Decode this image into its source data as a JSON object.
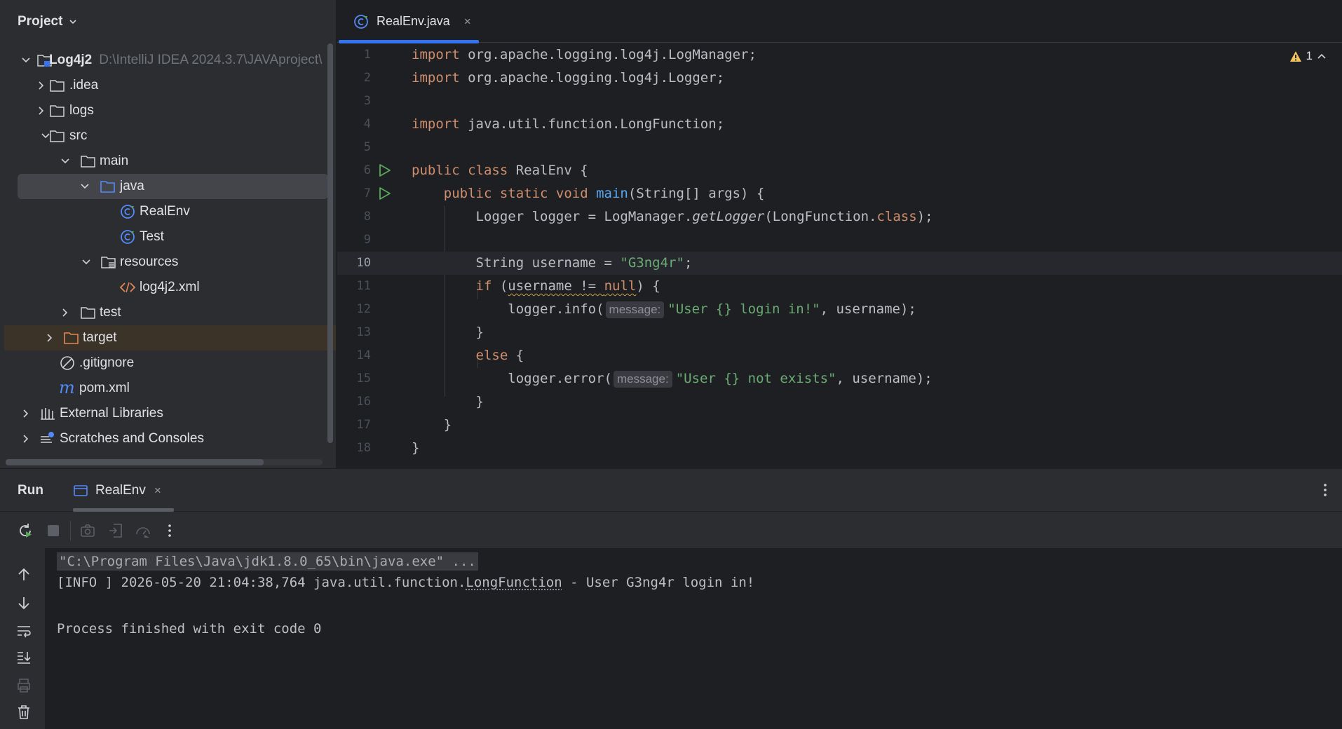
{
  "project": {
    "title": "Project",
    "tree": [
      {
        "label": "Log4j2",
        "hint": "D:\\IntelliJ IDEA 2024.3.7\\JAVAproject\\",
        "level": 0,
        "expanded": true,
        "icon": "module-folder-icon"
      },
      {
        "label": ".idea",
        "level": 1,
        "expanded": false,
        "icon": "folder-icon"
      },
      {
        "label": "logs",
        "level": 1,
        "expanded": false,
        "icon": "folder-icon"
      },
      {
        "label": "src",
        "level": 1,
        "expanded": true,
        "icon": "folder-icon"
      },
      {
        "label": "main",
        "level": 2,
        "expanded": true,
        "icon": "folder-icon"
      },
      {
        "label": "java",
        "level": 3,
        "expanded": true,
        "icon": "source-folder-icon"
      },
      {
        "label": "RealEnv",
        "level": 4,
        "icon": "java-class-icon"
      },
      {
        "label": "Test",
        "level": 4,
        "icon": "java-class-icon"
      },
      {
        "label": "resources",
        "level": 3,
        "expanded": true,
        "icon": "resources-folder-icon"
      },
      {
        "label": "log4j2.xml",
        "level": 4,
        "icon": "xml-file-icon"
      },
      {
        "label": "test",
        "level": 2,
        "expanded": false,
        "icon": "folder-icon"
      },
      {
        "label": "target",
        "level": 1,
        "expanded": false,
        "icon": "excluded-folder-icon"
      },
      {
        "label": ".gitignore",
        "level": 1,
        "icon": "ignore-file-icon"
      },
      {
        "label": "pom.xml",
        "level": 1,
        "icon": "maven-icon"
      },
      {
        "label": "External Libraries",
        "level": 0,
        "expanded": false,
        "icon": "libraries-icon"
      },
      {
        "label": "Scratches and Consoles",
        "level": 0,
        "expanded": false,
        "icon": "scratches-icon"
      }
    ]
  },
  "editor": {
    "tab": {
      "label": "RealEnv.java",
      "close": "×"
    },
    "warnings": "1",
    "current_line": 10,
    "line_numbers": [
      "1",
      "2",
      "3",
      "4",
      "5",
      "6",
      "7",
      "8",
      "9",
      "10",
      "11",
      "12",
      "13",
      "14",
      "15",
      "16",
      "17",
      "18"
    ],
    "code": {
      "l1": {
        "kw": "import",
        "rest": " org.apache.logging.log4j.LogManager;"
      },
      "l2": {
        "kw": "import",
        "rest": " org.apache.logging.log4j.Logger;"
      },
      "l4": {
        "kw": "import",
        "rest": " java.util.function.LongFunction;"
      },
      "l6": {
        "kw": "public class",
        "rest": " RealEnv {"
      },
      "l7": {
        "kw": "    public static void ",
        "fn": "main",
        "rest": "(String[] args) {"
      },
      "l8": {
        "a": "        Logger logger = LogManager.",
        "it": "getLogger",
        "b": "(LongFunction.",
        "kw": "class",
        "c": ");"
      },
      "l10": {
        "a": "        String username = ",
        "str": "\"G3ng4r\"",
        "c": ";"
      },
      "l11": {
        "a": "        ",
        "kw1": "if",
        "b": " (",
        "w1": "username != ",
        "kw2": "null",
        "c": ") {"
      },
      "l12": {
        "a": "            logger.info(",
        "hint": "message:",
        "str": "\"User {} login in!\"",
        "c": ", username);"
      },
      "l13": {
        "a": "        }"
      },
      "l14": {
        "a": "        ",
        "kw": "else",
        "c": " {"
      },
      "l15": {
        "a": "            logger.error(",
        "hint": "message:",
        "str": "\"User {} not exists\"",
        "c": ", username);"
      },
      "l16": {
        "a": "        }"
      },
      "l17": {
        "a": "    }"
      },
      "l18": {
        "a": "}"
      }
    }
  },
  "run": {
    "title": "Run",
    "tab": {
      "label": "RealEnv",
      "close": "×"
    },
    "console": {
      "cmd": "\"C:\\Program Files\\Java\\jdk1.8.0_65\\bin\\java.exe\" ...",
      "log_prefix": "[INFO ] 2026-05-20 21:04:38,764 java.util.function.",
      "log_class": "LongFunction",
      "log_suffix": " - User G3ng4r login in!",
      "exit": "Process finished with exit code 0"
    }
  },
  "colors": {
    "accent": "#3574f0",
    "keyword": "#cf8e6d",
    "string": "#6aab73",
    "function": "#56a8f5",
    "run_gutter": "#57a85a"
  }
}
